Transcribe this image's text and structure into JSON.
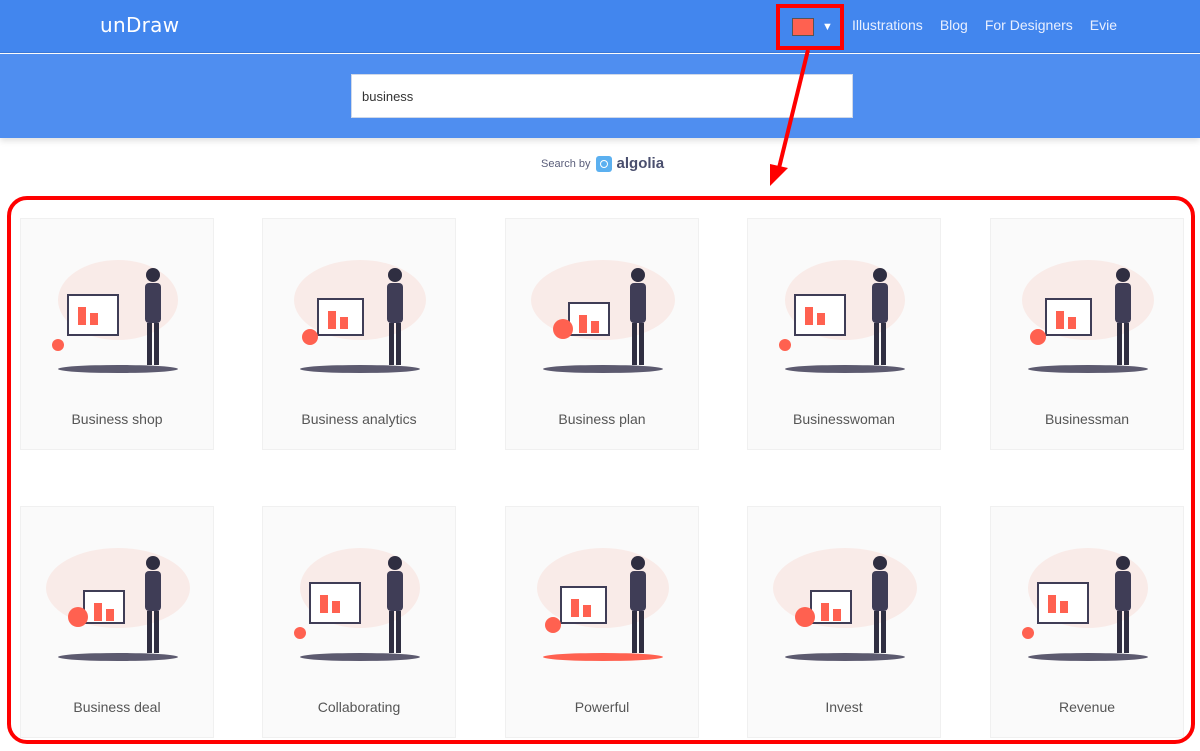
{
  "header": {
    "logo": "unDraw",
    "accent_color": "#ff6150",
    "nav": [
      "Illustrations",
      "Blog",
      "For Designers",
      "Evie"
    ]
  },
  "search": {
    "value": "business",
    "attribution_prefix": "Search by",
    "attribution_brand": "algolia"
  },
  "illustrations": [
    {
      "label": "Business shop",
      "icon": "shop-illustration"
    },
    {
      "label": "Business analytics",
      "icon": "analytics-illustration"
    },
    {
      "label": "Business plan",
      "icon": "presentation-illustration"
    },
    {
      "label": "Businesswoman",
      "icon": "businesswoman-illustration"
    },
    {
      "label": "Businessman",
      "icon": "businessman-illustration"
    },
    {
      "label": "Business deal",
      "icon": "handshake-illustration"
    },
    {
      "label": "Collaborating",
      "icon": "collaboration-illustration"
    },
    {
      "label": "Powerful",
      "icon": "powerful-illustration"
    },
    {
      "label": "Invest",
      "icon": "invest-illustration"
    },
    {
      "label": "Revenue",
      "icon": "revenue-illustration"
    }
  ]
}
